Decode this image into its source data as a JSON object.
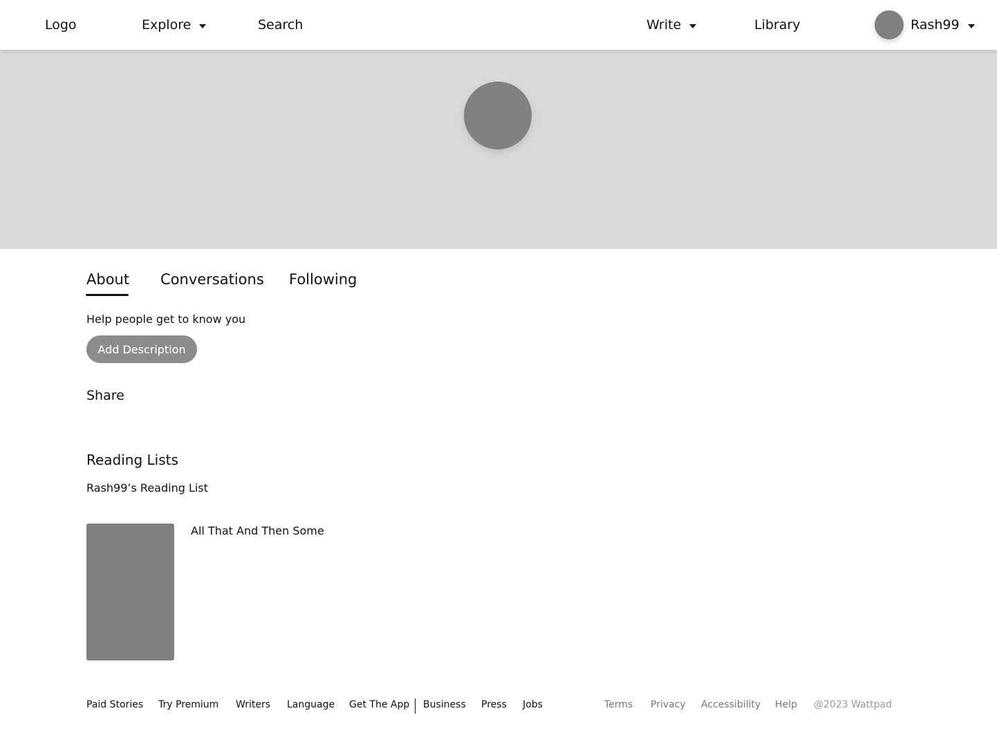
{
  "nav": {
    "logo": "Logo",
    "explore": "Explore",
    "search": "Search",
    "write": "Write",
    "library": "Library",
    "username": "Rash99"
  },
  "tabs": [
    {
      "label": "About"
    },
    {
      "label": "Conversations"
    },
    {
      "label": "Following"
    }
  ],
  "about": {
    "prompt": "Help people get to know you",
    "add_description": "Add Description",
    "share": "Share"
  },
  "reading_lists": {
    "title": "Reading Lists",
    "list_name": "Rash99’s Reading List",
    "books": [
      {
        "title": "All That And Then Some"
      }
    ]
  },
  "footer": {
    "left_links": [
      "Paid Stories",
      "Try Premium",
      "Writers",
      "Language",
      "Get The App",
      "Business",
      "Press",
      "Jobs"
    ],
    "right_links": [
      "Terms",
      "Privacy",
      "Accessibility",
      "Help"
    ],
    "copyright": "@2023 Wattpad"
  },
  "colors": {
    "banner": "#d9d9d9",
    "placeholder": "#808080",
    "button": "#8c8c8c",
    "muted_text": "#777777"
  }
}
